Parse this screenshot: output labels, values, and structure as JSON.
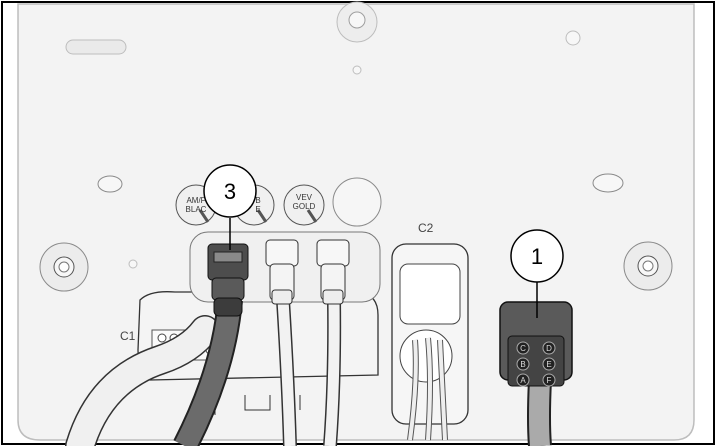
{
  "callouts": [
    {
      "number": "3"
    },
    {
      "number": "1"
    }
  ],
  "connector_labels": {
    "c1": "C1",
    "c2": "C2"
  },
  "button_labels": {
    "left_top": "AM/F",
    "left_bottom": "BLAC",
    "middle_top": "B",
    "middle_bottom": "E",
    "right_top": "VEV",
    "right_bottom": "GOLD"
  },
  "pin_labels": [
    "C",
    "D",
    "B",
    "E",
    "A",
    "F"
  ],
  "colors": {
    "panel": "#f2f2f2",
    "outline": "#1a1a1a",
    "dark_connector": "#5a5a5a",
    "cable_light": "#efefef",
    "cable_dark": "#6b6b6b"
  }
}
